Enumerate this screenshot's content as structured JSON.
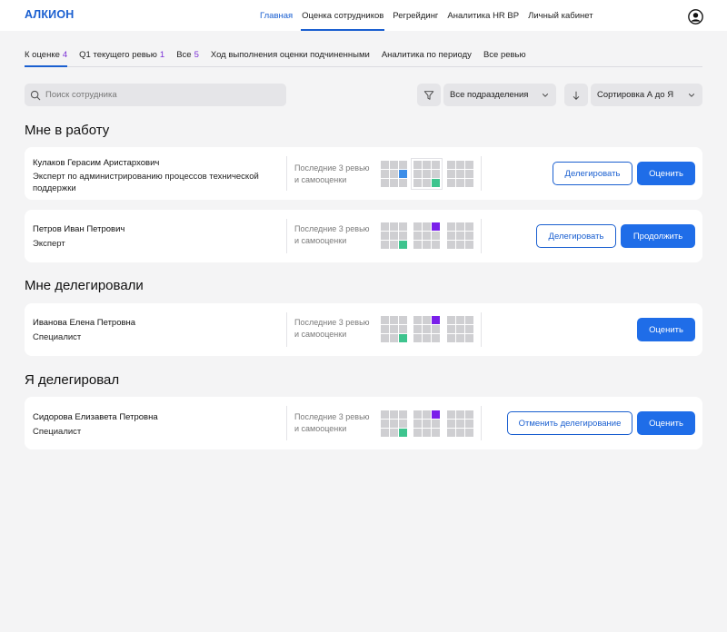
{
  "app": {
    "logo": "АЛКИОН"
  },
  "nav": [
    {
      "label": "Главная",
      "active": true
    },
    {
      "label": "Оценка сотрудников",
      "active": false,
      "underline": true
    },
    {
      "label": "Регрейдинг"
    },
    {
      "label": "Аналитика HR BP"
    },
    {
      "label": "Личный кабинет"
    }
  ],
  "tabs": [
    {
      "label": "К оценке",
      "count": "4",
      "active": true
    },
    {
      "label": "Q1 текущего ревью",
      "count": "1"
    },
    {
      "label": "Все",
      "count": "5"
    },
    {
      "label": "Ход выполнения оценки подчиненными",
      "count": ""
    },
    {
      "label": "Аналитика по периоду",
      "count": ""
    },
    {
      "label": "Все ревью",
      "count": ""
    }
  ],
  "filters": {
    "search_placeholder": "Поиск сотрудника",
    "department": "Все подразделения",
    "sort": "Сортировка А до Я"
  },
  "sections": {
    "my_work": "Мне в работу",
    "delegated_to_me": "Мне делегировали",
    "i_delegated": "Я делегировал"
  },
  "review_label": "Последние 3 ревью и самооценки",
  "cards": [
    {
      "name": "Кулаков Герасим Аристархович",
      "role": "Эксперт по администрированию процессов технической поддержки",
      "secondary": "Делегировать",
      "primary": "Оценить",
      "grids": [
        [
          "",
          "",
          "",
          "",
          "",
          "blue",
          "",
          "",
          ""
        ],
        [
          "",
          "",
          "",
          "",
          "",
          "",
          "",
          "",
          "green"
        ],
        [
          "",
          "",
          "",
          "",
          "",
          "",
          "",
          "",
          ""
        ]
      ]
    },
    {
      "name": "Петров Иван Петрович",
      "role": "Эксперт",
      "secondary": "Делегировать",
      "primary": "Продолжить",
      "grids": [
        [
          "",
          "",
          "",
          "",
          "",
          "",
          "",
          "",
          "green"
        ],
        [
          "",
          "",
          "purple",
          "",
          "",
          "",
          "",
          "",
          ""
        ],
        [
          "",
          "",
          "",
          "",
          "",
          "",
          "",
          "",
          ""
        ]
      ]
    },
    {
      "name": "Иванова Елена Петровна",
      "role": "Специалист",
      "secondary": "",
      "primary": "Оценить",
      "grids": [
        [
          "",
          "",
          "",
          "",
          "",
          "",
          "",
          "",
          "green"
        ],
        [
          "",
          "",
          "purple",
          "",
          "",
          "",
          "",
          "",
          ""
        ],
        [
          "",
          "",
          "",
          "",
          "",
          "",
          "",
          "",
          ""
        ]
      ]
    },
    {
      "name": "Сидорова Елизавета Петровна",
      "role": "Специалист",
      "secondary": "Отменить делегирование",
      "primary": "Оценить",
      "grids": [
        [
          "",
          "",
          "",
          "",
          "",
          "",
          "",
          "",
          "green"
        ],
        [
          "",
          "",
          "purple",
          "",
          "",
          "",
          "",
          "",
          ""
        ],
        [
          "",
          "",
          "",
          "",
          "",
          "",
          "",
          "",
          ""
        ]
      ]
    }
  ],
  "colors": {
    "accent": "#1f6de8",
    "count": "#7b2fd6",
    "blue_cell": "#3d8ee8",
    "green_cell": "#3ec48e",
    "purple_cell": "#7a1fea"
  },
  "icons": {
    "search": "search-icon",
    "filter": "filter-icon",
    "sort": "sort-arrow-icon",
    "avatar": "user-avatar-icon"
  }
}
